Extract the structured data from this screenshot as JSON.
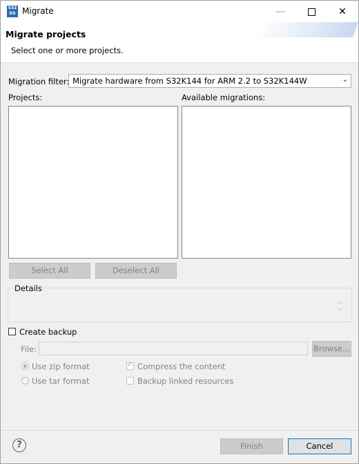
{
  "window": {
    "title": "Migrate",
    "app_icon_text": "S32 DS",
    "controls": {
      "minimize": "—",
      "close": "✕"
    }
  },
  "header": {
    "title": "Migrate projects",
    "description": "Select one or more projects."
  },
  "filter": {
    "label": "Migration filter:",
    "selected": "Migrate hardware from S32K144 for ARM 2.2 to S32K144W",
    "arrow": "⌄"
  },
  "projects": {
    "label": "Projects:",
    "items": []
  },
  "migrations": {
    "label": "Available migrations:",
    "items": []
  },
  "buttons": {
    "select_all": "Select All",
    "deselect_all": "Deselect All",
    "browse": "Browse...",
    "finish": "Finish",
    "cancel": "Cancel"
  },
  "details": {
    "label": "Details",
    "scroll_up": "︿",
    "scroll_down": "﹀"
  },
  "backup": {
    "create_backup": "Create backup",
    "file_label": "File:",
    "file_value": "",
    "use_zip": "Use zip format",
    "use_tar": "Use tar format",
    "compress": "Compress the content",
    "backup_linked": "Backup linked resources",
    "create_backup_checked": false,
    "compress_checked": true,
    "backup_linked_checked": false,
    "zip_selected": true
  },
  "help": {
    "icon": "?"
  },
  "icons": [
    "app-logo-icon",
    "minimize-icon",
    "maximize-icon",
    "close-icon",
    "dropdown-arrow-icon",
    "help-icon"
  ]
}
